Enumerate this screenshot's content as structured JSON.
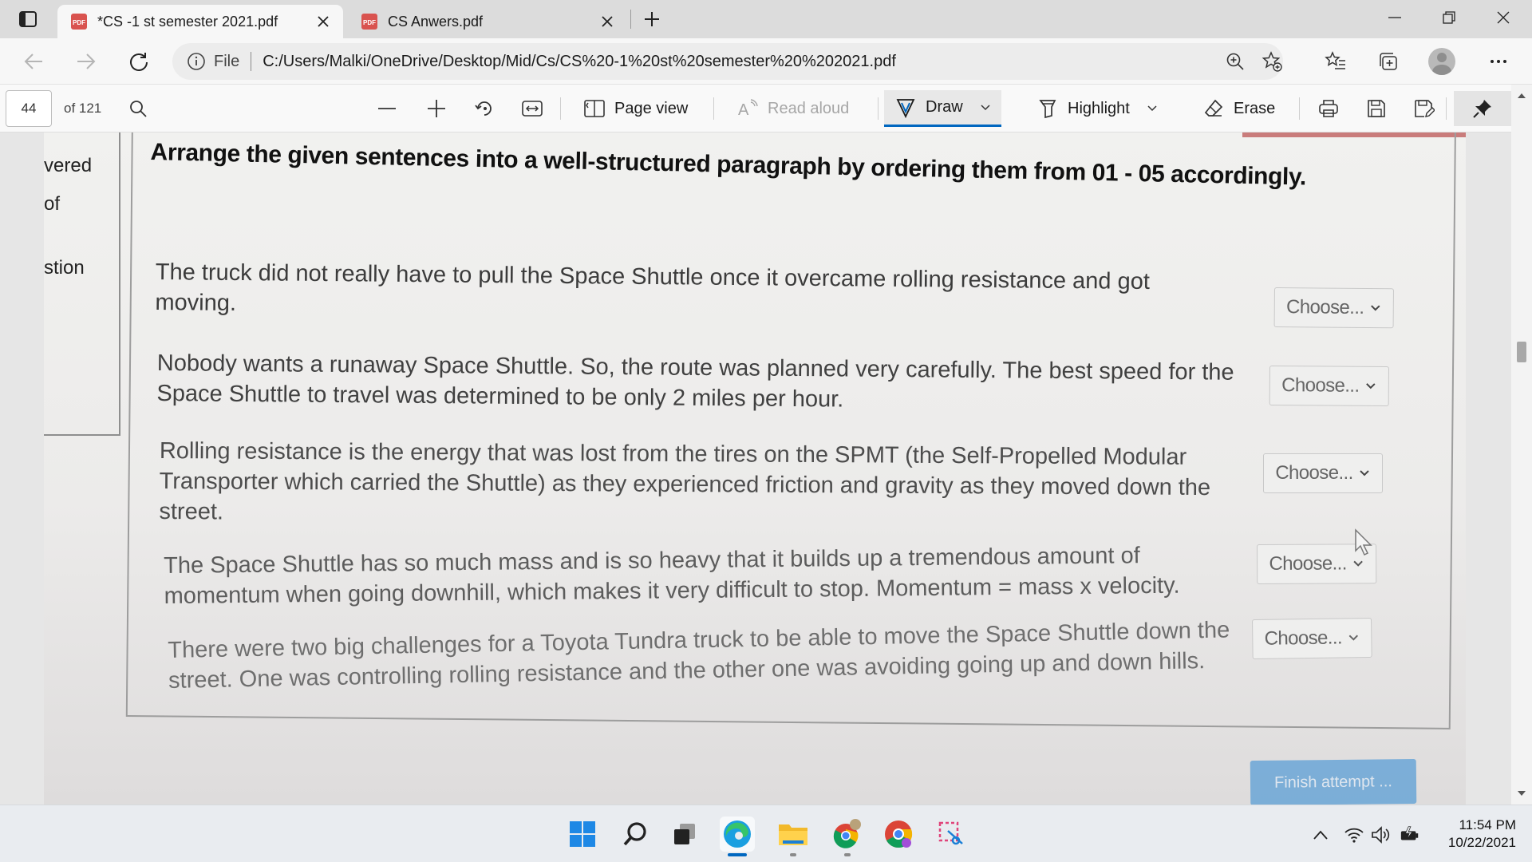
{
  "browser": {
    "tabs": [
      {
        "title": "*CS -1 st semester 2021.pdf",
        "badge": "PDF",
        "active": true
      },
      {
        "title": "CS Anwers.pdf",
        "badge": "PDF",
        "active": false
      }
    ],
    "address": {
      "scheme_label": "File",
      "url": "C:/Users/Malki/OneDrive/Desktop/Mid/Cs/CS%20-1%20st%20semester%20%202021.pdf"
    }
  },
  "pdf_toolbar": {
    "page_number": "44",
    "page_total": "of 121",
    "page_view": "Page view",
    "read_aloud": "Read aloud",
    "draw": "Draw",
    "highlight": "Highlight",
    "erase": "Erase"
  },
  "document": {
    "side_words": [
      "vered",
      "of",
      "stion"
    ],
    "instruction": "Arrange the given sentences into a well-structured paragraph by ordering them from 01 - 05 accordingly.",
    "sentences": [
      {
        "lines": [
          "The truck did not really have to pull the Space Shuttle once it overcame rolling resistance and got",
          "moving."
        ],
        "select": "Choose..."
      },
      {
        "lines": [
          "Nobody wants a runaway Space Shuttle. So, the route was planned very carefully. The best speed for the",
          "Space Shuttle to travel was determined to be only 2 miles per hour."
        ],
        "select": "Choose..."
      },
      {
        "lines": [
          "Rolling resistance is the energy that was lost from the tires on the SPMT (the Self-Propelled Modular",
          "Transporter which carried the Shuttle) as they experienced friction and gravity as they moved down the",
          "street."
        ],
        "select": "Choose..."
      },
      {
        "lines": [
          "The Space Shuttle has so much mass and is so heavy that it builds up a tremendous amount of",
          "momentum when going downhill, which makes it very difficult to stop. Momentum = mass x velocity."
        ],
        "select": "Choose..."
      },
      {
        "lines": [
          "There were two big challenges for a Toyota Tundra truck to be able to move the Space Shuttle down the",
          "street. One was controlling rolling resistance and the other one was avoiding going up and down hills."
        ],
        "select": "Choose..."
      }
    ],
    "finish_button": "Finish attempt ..."
  },
  "taskbar": {
    "time": "11:54 PM",
    "date": "10/22/2021"
  },
  "colors": {
    "accent": "#0067c0",
    "pdf_badge": "#d9534f",
    "finish_button": "#5b9fd6"
  }
}
